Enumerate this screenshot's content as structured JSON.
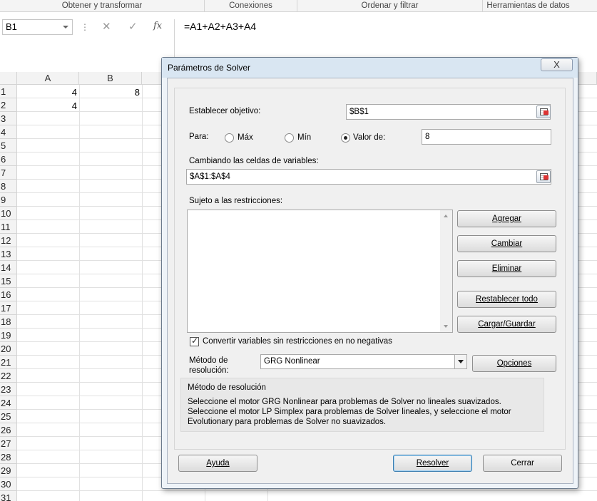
{
  "ribbon": {
    "groups": [
      "Obtener y transformar",
      "Conexiones",
      "Ordenar y filtrar",
      "Herramientas de datos"
    ]
  },
  "formula_bar": {
    "name_box": "B1",
    "formula": "=A1+A2+A3+A4"
  },
  "sheet": {
    "columns": [
      "A",
      "B"
    ],
    "rows": [
      "1",
      "2",
      "3",
      "4",
      "5",
      "6",
      "7",
      "8",
      "9",
      "10",
      "11",
      "12",
      "13",
      "14",
      "15",
      "16",
      "17",
      "18",
      "19",
      "20",
      "21",
      "22",
      "23",
      "24",
      "25",
      "26",
      "27",
      "28",
      "29",
      "30",
      "31"
    ],
    "cells": {
      "A1": "4",
      "B1": "8",
      "A2": "4"
    }
  },
  "dialog": {
    "title": "Parámetros de Solver",
    "close_label": "X",
    "objective_label": "Establecer objetivo:",
    "objective_value": "$B$1",
    "to_label": "Para:",
    "opt_max": "Máx",
    "opt_min": "Mín",
    "opt_value": "Valor de:",
    "selected_option": "Valor de:",
    "target_value": "8",
    "changing_label": "Cambiando las celdas de variables:",
    "changing_value": "$A$1:$A$4",
    "constraints_label": "Sujeto a las restricciones:",
    "btn_add": "Agregar",
    "btn_change": "Cambiar",
    "btn_delete": "Eliminar",
    "btn_reset": "Restablecer todo",
    "btn_loadsave": "Cargar/Guardar",
    "nonneg_label": "Convertir variables sin restricciones en no negativas",
    "nonneg_checked": true,
    "method_label_1": "Método de",
    "method_label_2": "resolución:",
    "method_value": "GRG Nonlinear",
    "btn_options": "Opciones",
    "desc_title": "Método de resolución",
    "desc_text": "Seleccione el motor GRG Nonlinear para problemas de Solver no lineales suavizados. Seleccione el motor LP Simplex para problemas de Solver lineales, y seleccione el motor Evolutionary para problemas de Solver no suavizados.",
    "btn_help": "Ayuda",
    "btn_solve": "Resolver",
    "btn_close": "Cerrar"
  }
}
